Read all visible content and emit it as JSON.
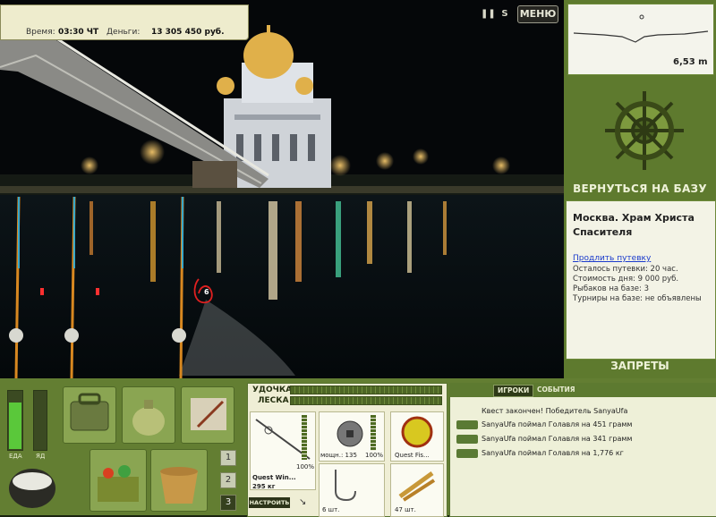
{
  "hud": {
    "time_label": "Время:",
    "time_value": "03:30 ЧТ",
    "money_label": "Деньги:",
    "money_value": "13 305 450 руб.",
    "pause_icon": "pause-icon",
    "sound_icon": "sound-icon",
    "menu_label": "МЕНЮ"
  },
  "depth": {
    "value": "6,53 m"
  },
  "side": {
    "return_label": "ВЕРНУТЬСЯ НА БАЗУ",
    "location_title": "Москва. Храм Христа Спасителя",
    "extend_link": "Продлить путевку",
    "info": [
      "Осталось путевки: 20 час.",
      "Стоимость дня: 9 000 руб.",
      "Рыбаков на базе: 3",
      "Турниры на базе: не объявлены"
    ],
    "bans_label": "ЗАПРЕТЫ"
  },
  "player": {
    "food_label": "ЕДА",
    "poison_label": "ЯД",
    "food_level": 0.8,
    "poison_level": 0.0,
    "rod_numbers": [
      "1",
      "2",
      "3"
    ],
    "active_rod": "3"
  },
  "tackle": {
    "rod_label": "УДОЧКА",
    "line_label": "ЛЕСКА",
    "rod_name": "Quest Win...",
    "rod_weight": "295 кг",
    "rod_pct": "100%",
    "reel_power": "мощн.: 135",
    "reel_pct": "100%",
    "line_name": "Quest Fis...",
    "hook_count": "6 шт.",
    "bait_count": "47 шт.",
    "setup_label": "НАСТРОИТЬ"
  },
  "chat": {
    "tabs": [
      "ИГРОКИ",
      "СОБЫТИЯ"
    ],
    "active_tab": "ИГРОКИ",
    "messages": [
      "Квест закончен! Победитель SanyaUfa",
      "SanyaUfa поймал Голавля на 451 грамм",
      "SanyaUfa поймал Голавля на 341 грамм",
      "SanyaUfa поймал Голавля на 1,776 кг"
    ]
  },
  "scene": {
    "bobber_number": "6",
    "colors": {
      "panel": "#637e32",
      "accent": "#e8ecd0",
      "alert": "#e02020"
    }
  }
}
